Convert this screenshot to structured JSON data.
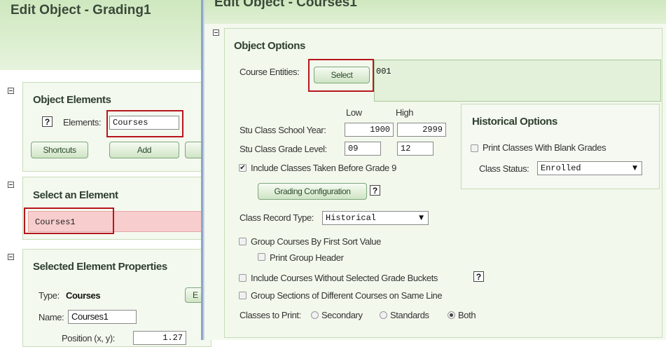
{
  "left": {
    "title": "Edit Object - Grading1",
    "object_elements": {
      "title": "Object Elements",
      "help": "?",
      "elements_label": "Elements:",
      "elements_value": "Courses",
      "shortcuts_label": "Shortcuts",
      "add_label": "Add"
    },
    "select_element": {
      "title": "Select an Element",
      "selected_item": "Courses1"
    },
    "properties": {
      "title": "Selected Element Properties",
      "type_label": "Type:",
      "type_value": "Courses",
      "edit_partial": "E",
      "name_label": "Name:",
      "name_value": "Courses1",
      "position_label": "Position (x, y):",
      "position_value": "1.27"
    }
  },
  "right": {
    "title": "Edit Object - Courses1",
    "object_options": {
      "title": "Object Options",
      "course_entities_label": "Course Entities:",
      "select_label": "Select",
      "course_entities_value": "001",
      "low_header": "Low",
      "high_header": "High",
      "school_year_label": "Stu Class School Year:",
      "school_year_low": "1900",
      "school_year_high": "2999",
      "grade_level_label": "Stu Class Grade Level:",
      "grade_level_low": "09",
      "grade_level_high": "12",
      "include_before_9_label": "Include Classes Taken Before Grade 9",
      "grading_config_label": "Grading Configuration",
      "help": "?",
      "record_type_label": "Class Record Type:",
      "record_type_value": "Historical",
      "group_first_sort_label": "Group Courses By First Sort Value",
      "print_group_header_label": "Print Group Header",
      "include_without_buckets_label": "Include Courses Without Selected Grade Buckets",
      "group_sections_label": "Group Sections of Different Courses on Same Line",
      "classes_to_print_label": "Classes to Print:",
      "opt_secondary": "Secondary",
      "opt_standards": "Standards",
      "opt_both": "Both"
    },
    "historical": {
      "title": "Historical Options",
      "print_blank_label": "Print Classes With Blank Grades",
      "status_label": "Class Status:",
      "status_value": "Enrolled"
    }
  },
  "icons": {
    "collapse": "collapse-minus-icon",
    "help": "help-question-icon",
    "dropdown": "chevron-down-icon",
    "check": "checkmark-icon"
  }
}
